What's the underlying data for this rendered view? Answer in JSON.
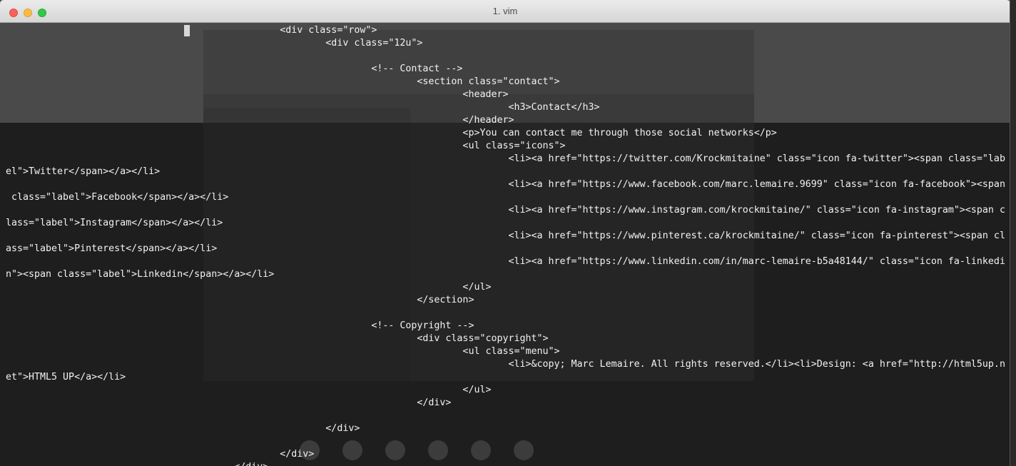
{
  "window": {
    "title": "1. vim"
  },
  "editor": {
    "lines": [
      "                                                <div class=\"row\">",
      "                                                        <div class=\"12u\">",
      "",
      "                                                                <!-- Contact -->",
      "                                                                        <section class=\"contact\">",
      "                                                                                <header>",
      "                                                                                        <h3>Contact</h3>",
      "                                                                                </header>",
      "                                                                                <p>You can contact me through those social networks</p>",
      "                                                                                <ul class=\"icons\">",
      "                                                                                        <li><a href=\"https://twitter.com/Krockmitaine\" class=\"icon fa-twitter\"><span class=\"lab",
      "el\">Twitter</span></a></li>",
      "                                                                                        <li><a href=\"https://www.facebook.com/marc.lemaire.9699\" class=\"icon fa-facebook\"><span",
      " class=\"label\">Facebook</span></a></li>",
      "                                                                                        <li><a href=\"https://www.instagram.com/krockmitaine/\" class=\"icon fa-instagram\"><span c",
      "lass=\"label\">Instagram</span></a></li>",
      "                                                                                        <li><a href=\"https://www.pinterest.ca/krockmitaine/\" class=\"icon fa-pinterest\"><span cl",
      "ass=\"label\">Pinterest</span></a></li>",
      "                                                                                        <li><a href=\"https://www.linkedin.com/in/marc-lemaire-b5a48144/\" class=\"icon fa-linkedi",
      "n\"><span class=\"label\">Linkedin</span></a></li>",
      "                                                                                </ul>",
      "                                                                        </section>",
      "",
      "                                                                <!-- Copyright -->",
      "                                                                        <div class=\"copyright\">",
      "                                                                                <ul class=\"menu\">",
      "                                                                                        <li>&copy; Marc Lemaire. All rights reserved.</li><li>Design: <a href=\"http://html5up.n",
      "et\">HTML5 UP</a></li>",
      "                                                                                </ul>",
      "                                                                        </div>",
      "",
      "                                                        </div>",
      "",
      "                                                </div>",
      "                                        </div>"
    ]
  }
}
